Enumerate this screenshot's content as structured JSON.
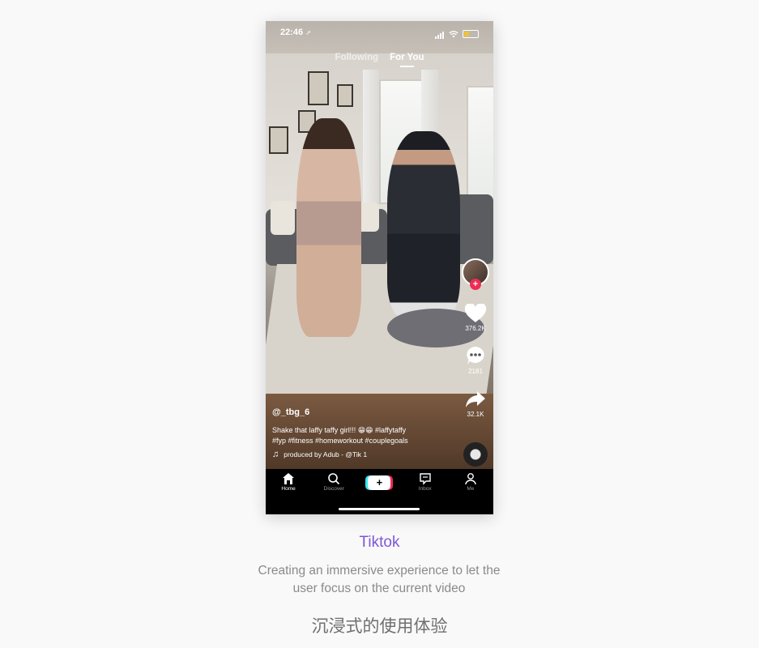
{
  "status_bar": {
    "time": "22:46",
    "location_arrow": "➚"
  },
  "feed_tabs": [
    {
      "label": "Following",
      "active": false
    },
    {
      "label": "For You",
      "active": true
    }
  ],
  "actions": {
    "likes": "376.2K",
    "comments": "2181",
    "shares": "32.1K"
  },
  "post": {
    "username": "@_tbg_6",
    "description_line1": "Shake that laffy taffy girl!!! 😁😁 #laffytaffy",
    "description_line2": "#fyp #fitness #homeworkout #couplegoals",
    "music": "produced by Adub - @Tik 1",
    "music_icon": "♫"
  },
  "navbar": {
    "home": "Home",
    "discover": "Discover",
    "create": "+",
    "inbox": "Inbox",
    "me": "Me"
  },
  "showcase": {
    "title": "Tiktok",
    "description": "Creating an immersive experience to let the user focus on the current video",
    "description_cn": "沉浸式的使用体验"
  },
  "colors": {
    "accent": "#7e56d6",
    "tiktok_red": "#ee2d55",
    "tiktok_cyan": "#35e4ee"
  }
}
